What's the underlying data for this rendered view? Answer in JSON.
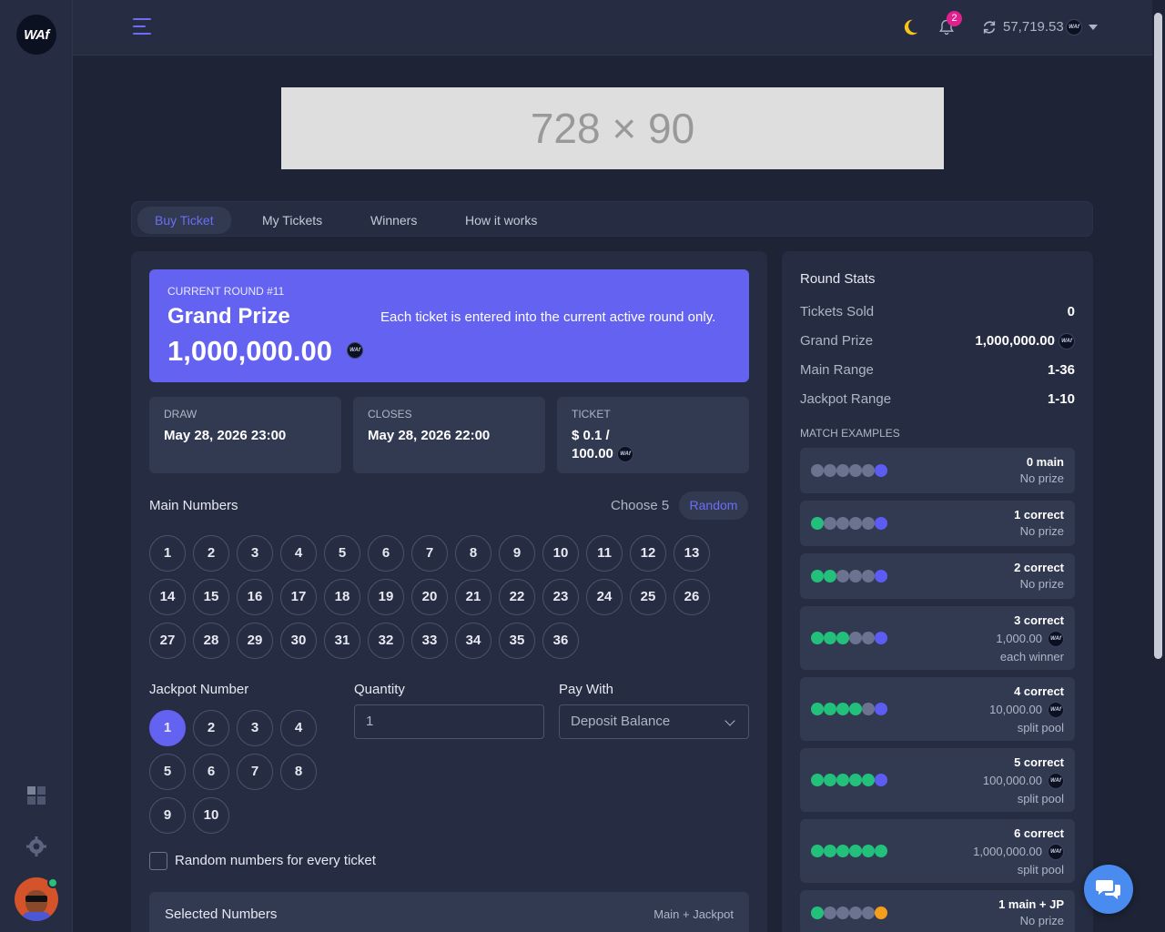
{
  "header": {
    "logo_text": "WAf",
    "notification_count": "2",
    "balance": "57,719.53",
    "coin_text": "WAf"
  },
  "banner": {
    "text": "728 × 90"
  },
  "tabs": [
    {
      "label": "Buy Ticket",
      "active": true
    },
    {
      "label": "My Tickets"
    },
    {
      "label": "Winners"
    },
    {
      "label": "How it works"
    }
  ],
  "hero": {
    "round": "CURRENT ROUND #11",
    "label": "Grand Prize",
    "value": "1,000,000.00",
    "note": "Each ticket is entered into the current active round only."
  },
  "info": {
    "draw_label": "DRAW",
    "draw_value": "May 28, 2026 23:00",
    "closes_label": "CLOSES",
    "closes_value": "May 28, 2026 22:00",
    "ticket_label": "TICKET",
    "ticket_value_1": "$ 0.1 /",
    "ticket_value_2": "100.00"
  },
  "main_numbers": {
    "title": "Main Numbers",
    "choose": "Choose 5",
    "random": "Random",
    "numbers": [
      "1",
      "2",
      "3",
      "4",
      "5",
      "6",
      "7",
      "8",
      "9",
      "10",
      "11",
      "12",
      "13",
      "14",
      "15",
      "16",
      "17",
      "18",
      "19",
      "20",
      "21",
      "22",
      "23",
      "24",
      "25",
      "26",
      "27",
      "28",
      "29",
      "30",
      "31",
      "32",
      "33",
      "34",
      "35",
      "36"
    ]
  },
  "jackpot": {
    "title": "Jackpot Number",
    "numbers": [
      "1",
      "2",
      "3",
      "4",
      "5",
      "6",
      "7",
      "8",
      "9",
      "10"
    ],
    "selected": "1"
  },
  "quantity": {
    "label": "Quantity",
    "value": "1"
  },
  "pay_with": {
    "label": "Pay With",
    "value": "Deposit Balance"
  },
  "random_every": {
    "label": "Random numbers for every ticket",
    "checked": false
  },
  "selected_numbers": {
    "title": "Selected Numbers",
    "subtitle": "Main + Jackpot"
  },
  "round_stats": {
    "title": "Round Stats",
    "tickets_sold_label": "Tickets Sold",
    "tickets_sold": "0",
    "grand_prize_label": "Grand Prize",
    "grand_prize": "1,000,000.00",
    "main_range_label": "Main Range",
    "main_range": "1-36",
    "jackpot_range_label": "Jackpot Range",
    "jackpot_range": "1-10",
    "match_title": "MATCH EXAMPLES"
  },
  "match_examples": [
    {
      "title": "0 main",
      "prize": "No prize",
      "green": 0,
      "last": "blue"
    },
    {
      "title": "1 correct",
      "prize": "No prize",
      "green": 1,
      "last": "blue"
    },
    {
      "title": "2 correct",
      "prize": "No prize",
      "green": 2,
      "last": "blue"
    },
    {
      "title": "3 correct",
      "amount": "1,000.00",
      "note": "each winner",
      "green": 3,
      "last": "blue"
    },
    {
      "title": "4 correct",
      "amount": "10,000.00",
      "note": "split pool",
      "green": 4,
      "last": "blue"
    },
    {
      "title": "5 correct",
      "amount": "100,000.00",
      "note": "split pool",
      "green": 5,
      "last": "blue"
    },
    {
      "title": "6 correct",
      "amount": "1,000,000.00",
      "note": "split pool",
      "green": 6,
      "last": "green"
    },
    {
      "title": "1 main + JP",
      "prize": "No prize",
      "green": 1,
      "last": "orange"
    }
  ],
  "colors": {
    "accent": "#6462f0",
    "green": "#22c07a",
    "orange": "#f59e1b",
    "bg": "#1e2435",
    "card": "#262d42"
  },
  "icons": [
    "hamburger-icon",
    "moon-icon",
    "bell-icon",
    "refresh-icon",
    "caret-down-icon",
    "dashboard-icon",
    "gear-icon",
    "chat-icon"
  ]
}
